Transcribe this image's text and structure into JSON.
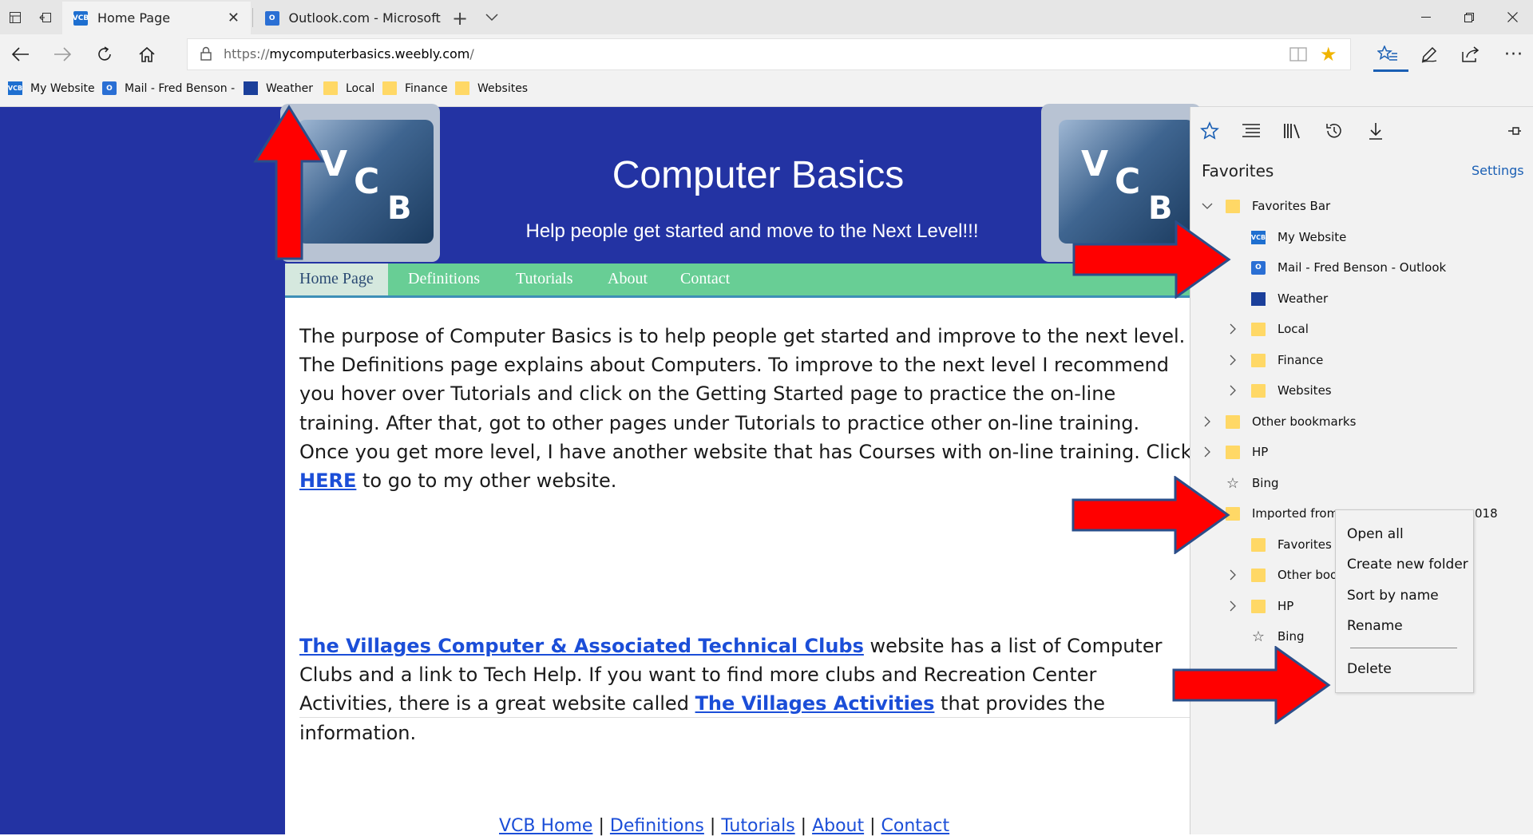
{
  "browser": {
    "tabs": [
      {
        "label": "Home Page",
        "icon": "vcb-favicon"
      },
      {
        "label": "Outlook.com - Microsoft fre",
        "icon": "outlook-favicon"
      }
    ],
    "url": {
      "prefix": "https://",
      "domain": "mycomputerbasics.weebly.com",
      "suffix": "/"
    },
    "favorites_bar": [
      {
        "label": "My Website",
        "icon": "vcb-icon"
      },
      {
        "label": "Mail - Fred Benson -",
        "icon": "outlook-icon"
      },
      {
        "label": "Weather",
        "icon": "weather-icon"
      },
      {
        "label": "Local",
        "icon": "folder-icon"
      },
      {
        "label": "Finance",
        "icon": "folder-icon"
      },
      {
        "label": "Websites",
        "icon": "folder-icon"
      }
    ]
  },
  "site": {
    "logo_letters": [
      "V",
      "C",
      "B"
    ],
    "title": "Computer Basics",
    "tagline": "Help people get started and move to the Next Level!!!",
    "menu": [
      "Home Page",
      "Definitions",
      "Tutorials",
      "About",
      "Contact"
    ],
    "para1": {
      "lines": [
        "The purpose of Computer Basics is to help people get started and improve to the next level.",
        "The Definitions page explains about Computers.  To improve to the next level I recommend",
        "you hover over Tutorials and click on the Getting Started page to practice the on-line",
        "training.  After that, got to other pages under Tutorials to practice other on-line training.",
        "Once you get more level, I have another website that has Courses with on-line training.  Click"
      ],
      "here_link": "HERE",
      "here_rest": " to go to my other website."
    },
    "para2": {
      "link1": "The Villages Computer & Associated Technical Clubs",
      "line1_rest": " website has a list of Computer",
      "line2": "Clubs and a link to Tech Help.  If you want to find more clubs and Recreation Center",
      "line3_start": "Activities, there is a great website called ",
      "link2": "The Villages Activities",
      "line3_rest": " that provides the",
      "line4": "information."
    },
    "footer": [
      "VCB Home",
      "Definitions",
      "Tutorials",
      "About",
      "Contact"
    ],
    "footer_sep": "|"
  },
  "hub": {
    "title": "Favorites",
    "settings": "Settings",
    "items": [
      {
        "label": "Favorites Bar",
        "icon": "folder-icon",
        "chevron": "down"
      },
      {
        "label": "My Website",
        "icon": "vcb-icon"
      },
      {
        "label": "Mail - Fred Benson - Outlook",
        "icon": "outlook-icon"
      },
      {
        "label": "Weather",
        "icon": "weather-icon"
      },
      {
        "label": "Local",
        "icon": "folder-icon",
        "chevron": "right"
      },
      {
        "label": "Finance",
        "icon": "folder-icon",
        "chevron": "right"
      },
      {
        "label": "Websites",
        "icon": "folder-icon",
        "chevron": "right"
      },
      {
        "label": "Other bookmarks",
        "icon": "folder-icon",
        "chevron": "right"
      },
      {
        "label": "HP",
        "icon": "folder-icon",
        "chevron": "right"
      },
      {
        "label": "Bing",
        "icon": "star-icon"
      },
      {
        "label": "Imported from",
        "label_tail": "018",
        "icon": "folder-icon"
      },
      {
        "label": "Favorites E",
        "icon": "folder-icon"
      },
      {
        "label": "Other boo",
        "icon": "folder-icon",
        "chevron": "right"
      },
      {
        "label": "HP",
        "icon": "folder-icon",
        "chevron": "right"
      },
      {
        "label": "Bing",
        "icon": "star-icon"
      }
    ]
  },
  "context_menu": [
    "Open all",
    "Create new folder",
    "Sort by name",
    "Rename",
    "Delete"
  ],
  "colors": {
    "site_blue": "#2333a3",
    "menu_green": "#68ce95",
    "link_blue": "#1b4ed8",
    "arrow_red": "#ff0000",
    "arrow_outline": "#2b4e8a"
  }
}
